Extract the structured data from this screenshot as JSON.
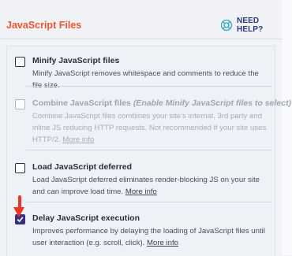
{
  "header": {
    "title": "JavaScript Files",
    "help_label": "NEED HELP?",
    "help_icon": "lifebuoy-icon",
    "title_color": "#f0552f"
  },
  "options": [
    {
      "title": "Minify JavaScript files",
      "title_hint": "",
      "desc": "Minify JavaScript removes whitespace and comments to reduce the file size.",
      "link": "",
      "checked": false,
      "disabled": false
    },
    {
      "title": "Combine JavaScript files",
      "title_hint": "(Enable Minify JavaScript files to select)",
      "desc": "Combine JavaScript files combines your site’s internal, 3rd party and inline JS reducing HTTP requests. Not recommended if your site uses HTTP/2.",
      "link": "More info",
      "checked": false,
      "disabled": true
    },
    {
      "title": "Load JavaScript deferred",
      "title_hint": "",
      "desc": "Load JavaScript deferred eliminates render-blocking JS on your site and can improve load time.",
      "link": "More info",
      "checked": false,
      "disabled": false
    },
    {
      "title": "Delay JavaScript execution",
      "title_hint": "",
      "desc": "Improves performance by delaying the loading of JavaScript files until user interaction (e.g. scroll, click).",
      "link": "More info",
      "checked": true,
      "disabled": false
    }
  ],
  "accent_checkbox": "#3a2f82",
  "annotation_arrow_color": "#e8372a"
}
